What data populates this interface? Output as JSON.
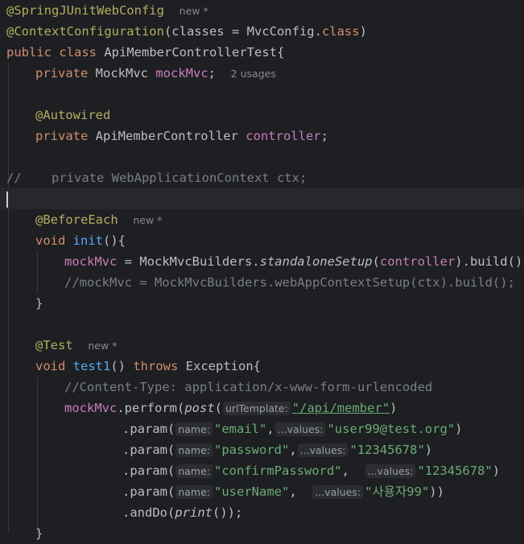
{
  "code": {
    "l1_annotation": "@SpringJUnitWebConfig",
    "l1_hint": "new *",
    "l2_annotation": "@ContextConfiguration",
    "l2_rest": "(classes = MvcConfig.",
    "l2_class_kw": "class",
    "l2_close": ")",
    "l3_public": "public",
    "l3_class": "class",
    "l3_name": " ApiMemberControllerTest{",
    "l4_private": "private",
    "l4_type": " MockMvc ",
    "l4_field": "mockMvc",
    "l4_semi": ";",
    "l4_hint": "2 usages",
    "l6_annotation": "@Autowired",
    "l7_private": "private",
    "l7_type": " ApiMemberController ",
    "l7_field": "controller",
    "l7_semi": ";",
    "l9_comment": "//    private WebApplicationContext ctx;",
    "l11_annotation": "@BeforeEach",
    "l11_hint": "new *",
    "l12_void": "void",
    "l12_fn": "init",
    "l12_rest": "(){",
    "l13_field": "mockMvc",
    "l13_a": " = MockMvcBuilders.",
    "l13_static": "standaloneSetup",
    "l13_b": "(",
    "l13_field2": "controller",
    "l13_c": ").build();",
    "l14_comment": "//mockMvc = MockMvcBuilders.webAppContextSetup(ctx).build();",
    "l15_close": "}",
    "l17_annotation": "@Test",
    "l17_hint": "new *",
    "l18_void": "void",
    "l18_fn": "test1",
    "l18_a": "() ",
    "l18_throws": "throws",
    "l18_b": " Exception{",
    "l19_comment": "//Content-Type: application/x-www-form-urlencoded",
    "l20_field": "mockMvc",
    "l20_a": ".perform(",
    "l20_static": "post",
    "l20_b": "(",
    "l20_hint": "urlTemplate:",
    "l20_url": "\"/api/member\"",
    "l20_c": ")",
    "p1_a": ".param(",
    "p1_hint1": "name:",
    "p1_str1": "\"email\"",
    "p1_sep": ",",
    "p1_hint2": "...values:",
    "p1_str2": "\"user99@test.org\"",
    "p1_close": ")",
    "p2_a": ".param(",
    "p2_hint1": "name:",
    "p2_str1": "\"password\"",
    "p2_sep": ",",
    "p2_hint2": "...values:",
    "p2_str2": "\"12345678\"",
    "p2_close": ")",
    "p3_a": ".param(",
    "p3_hint1": "name:",
    "p3_str1": "\"confirmPassword\"",
    "p3_sep": ",  ",
    "p3_hint2": "...values:",
    "p3_str2": "\"12345678\"",
    "p3_close": ")",
    "p4_a": ".param(",
    "p4_hint1": "name:",
    "p4_str1": "\"userName\"",
    "p4_sep": ",  ",
    "p4_hint2": "...values:",
    "p4_str2": "\"사용자99\"",
    "p4_close": "))",
    "l25_a": ".andDo(",
    "l25_static": "print",
    "l25_b": "());",
    "l26_close": "}"
  }
}
